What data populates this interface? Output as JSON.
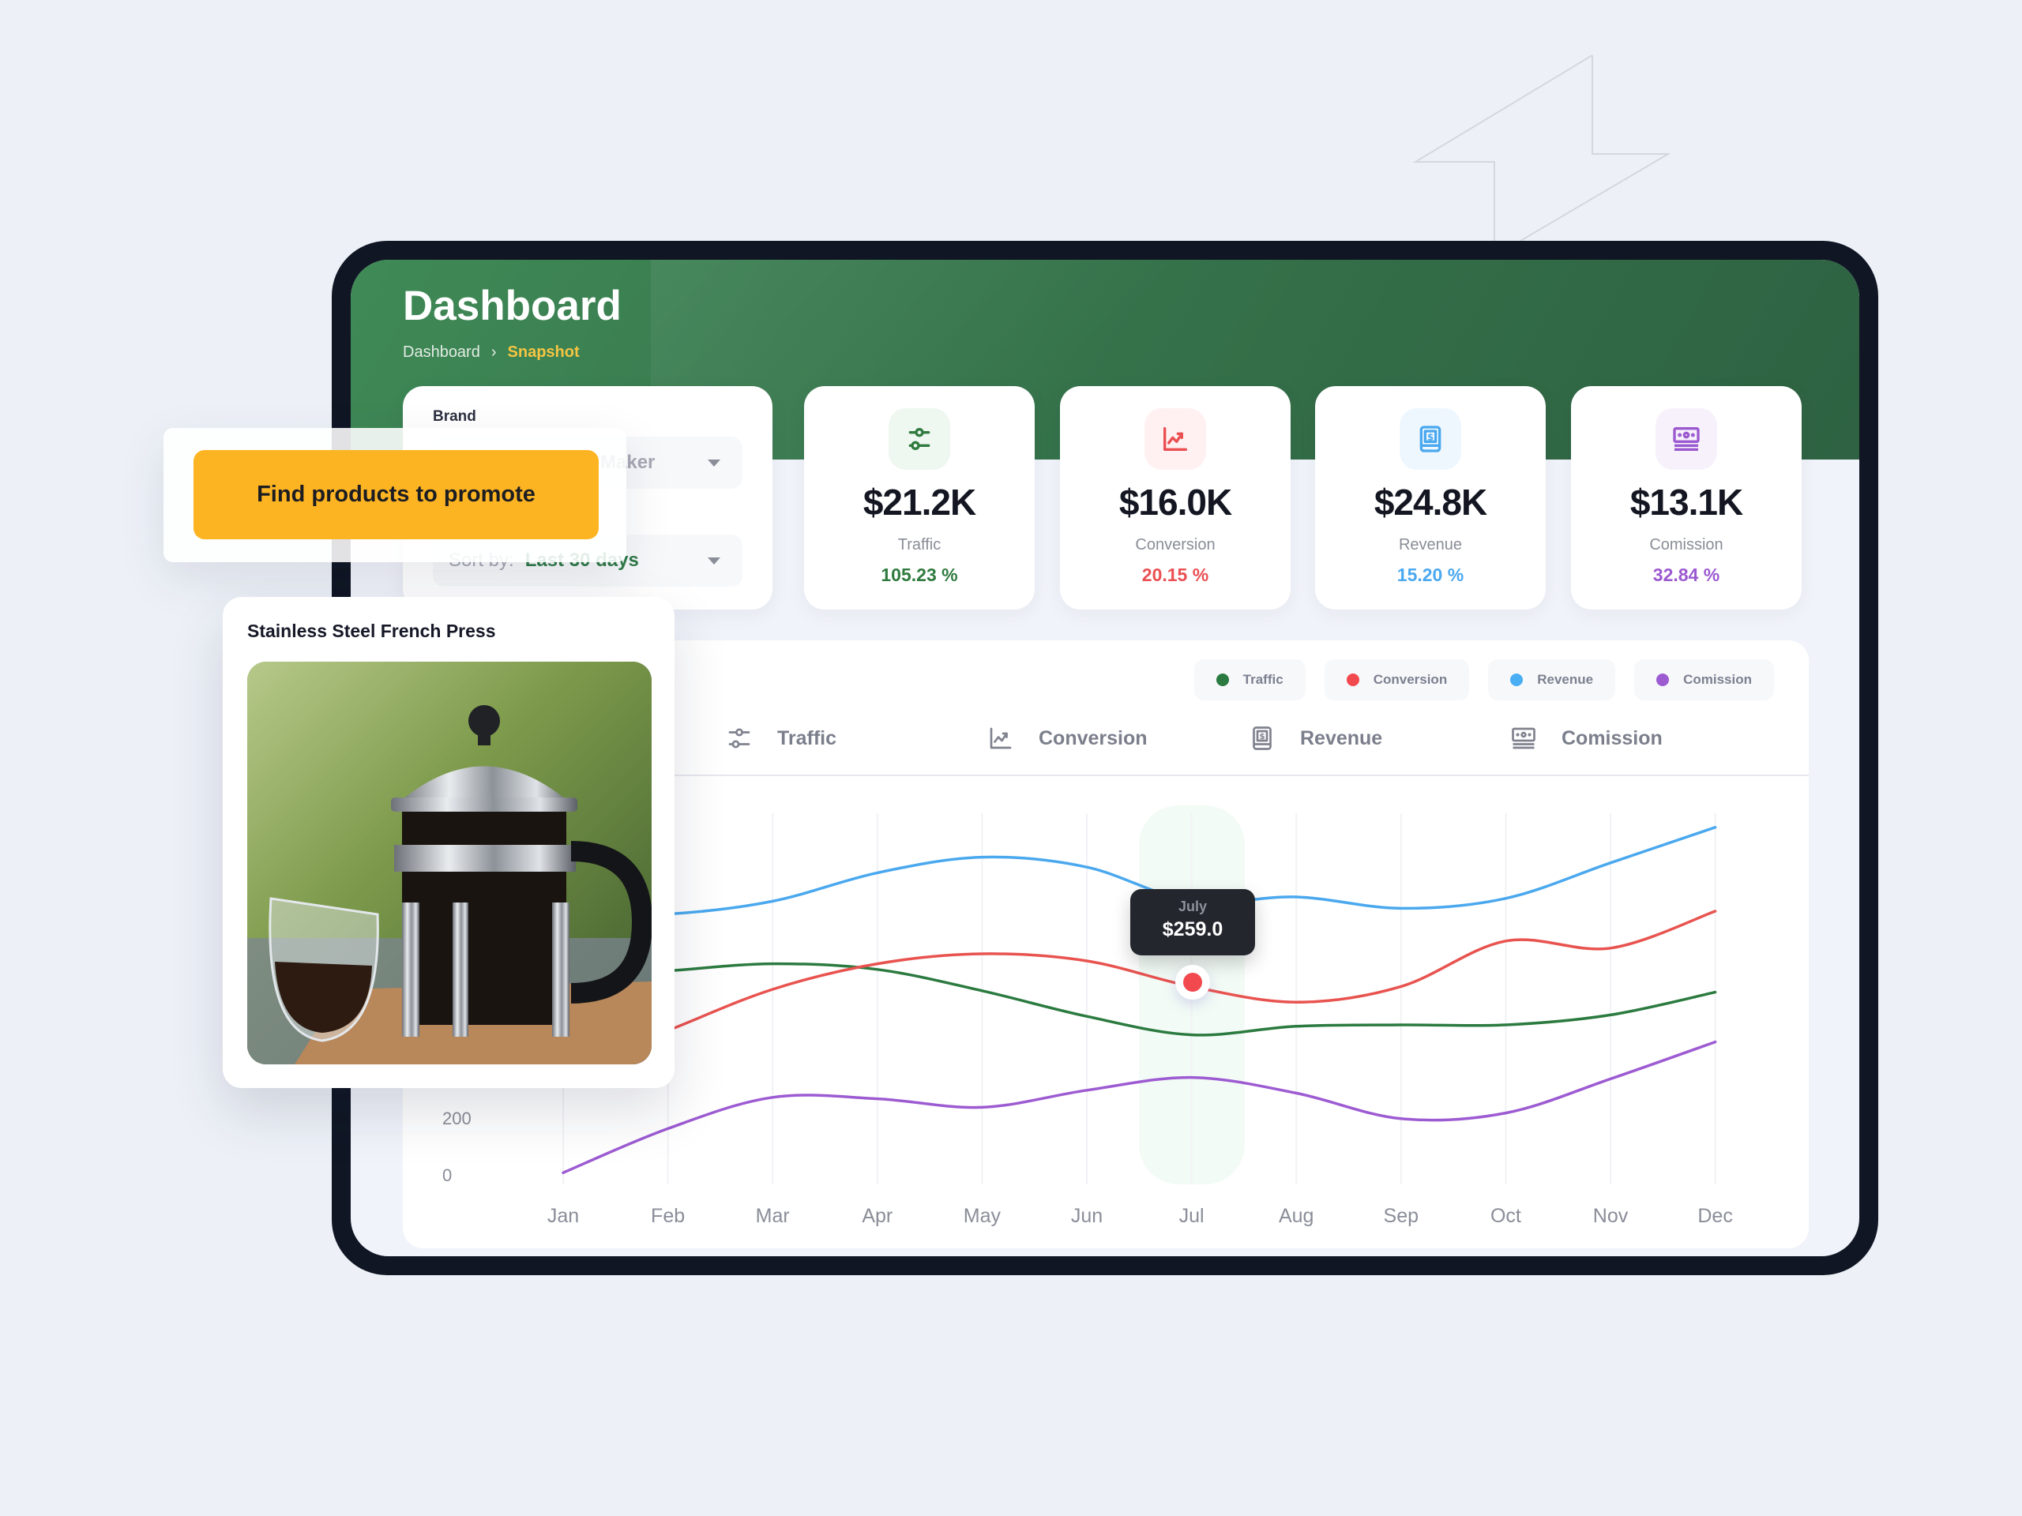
{
  "header": {
    "title": "Dashboard",
    "breadcrumb": [
      {
        "label": "Dashboard"
      },
      {
        "label": "Snapshot"
      }
    ],
    "breadcrumb_separator": "›"
  },
  "filters": {
    "brand_label": "Brand",
    "brand_value": "Maker",
    "sort_label": "Sort by:",
    "sort_value": "Last 30 days"
  },
  "stats": [
    {
      "icon": "sliders-icon",
      "value": "$21.2K",
      "label": "Traffic",
      "change": "105.23 %",
      "color": "#2f7a3e",
      "bg": "#eef7f0"
    },
    {
      "icon": "trend-chart-icon",
      "value": "$16.0K",
      "label": "Conversion",
      "change": "20.15 %",
      "color": "#ea4f52",
      "bg": "#fff1f1"
    },
    {
      "icon": "dollar-tablet-icon",
      "value": "$24.8K",
      "label": "Revenue",
      "change": "15.20 %",
      "color": "#4aa8ef",
      "bg": "#eef7fe"
    },
    {
      "icon": "cash-stack-icon",
      "value": "$13.1K",
      "label": "Comission",
      "change": "32.84 %",
      "color": "#9b59d0",
      "bg": "#f7f1fc"
    }
  ],
  "tabs": [
    {
      "label": "Traffic",
      "icon": "sliders-icon"
    },
    {
      "label": "Conversion",
      "icon": "trend-chart-icon"
    },
    {
      "label": "Revenue",
      "icon": "dollar-tablet-icon"
    },
    {
      "label": "Comission",
      "icon": "cash-stack-icon"
    }
  ],
  "cta": {
    "label": "Find products to promote"
  },
  "product": {
    "title": "Stainless Steel French Press"
  },
  "tooltip": {
    "label": "July",
    "value": "$259.0",
    "series": "Conversion",
    "month_index": 6
  },
  "chart_data": {
    "type": "line",
    "title": "",
    "xlabel": "",
    "ylabel": "",
    "categories": [
      "Jan",
      "Feb",
      "Mar",
      "Apr",
      "May",
      "Jun",
      "Jul",
      "Aug",
      "Sep",
      "Oct",
      "Nov",
      "Dec"
    ],
    "yticks": [
      0,
      200
    ],
    "ylim": [
      0,
      1260
    ],
    "grid": "vertical",
    "legend_position": "top-right",
    "series": [
      {
        "name": "Traffic",
        "color": "#2b7a3f",
        "values": [
          690,
          715,
          740,
          720,
          645,
          555,
          490,
          520,
          525,
          525,
          560,
          640
        ]
      },
      {
        "name": "Conversion",
        "color": "#e8534f",
        "values": [
          360,
          505,
          650,
          740,
          775,
          750,
          660,
          605,
          660,
          820,
          795,
          925
        ]
      },
      {
        "name": "Revenue",
        "color": "#4aa8ee",
        "values": [
          915,
          915,
          960,
          1060,
          1115,
          1080,
          960,
          975,
          935,
          970,
          1095,
          1220
        ]
      },
      {
        "name": "Comission",
        "color": "#9d5bd2",
        "values": [
          5,
          160,
          270,
          265,
          235,
          295,
          340,
          285,
          195,
          215,
          335,
          465
        ]
      }
    ]
  }
}
